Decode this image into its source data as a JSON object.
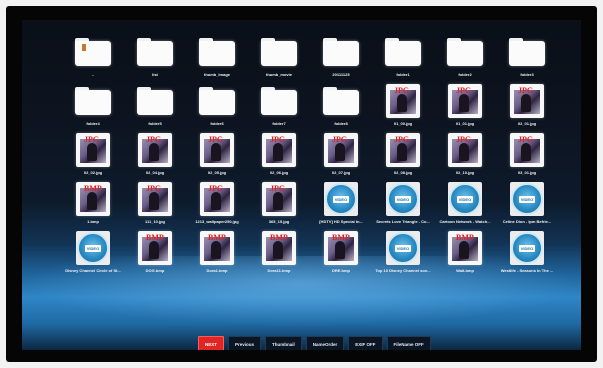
{
  "toolbar": {
    "buttons": [
      {
        "label": "NEXT",
        "active": true
      },
      {
        "label": "Previous",
        "active": false
      },
      {
        "label": "Thumbnail",
        "active": false
      },
      {
        "label": "NameOrder",
        "active": false
      },
      {
        "label": "EXIF OFF",
        "active": false
      },
      {
        "label": "FileName OFF",
        "active": false
      }
    ]
  },
  "colors": {
    "active_button": "#e02525",
    "screen_glow": "#2f86c6",
    "video_accent": "#2a8cc4"
  },
  "files": [
    {
      "type": "folder",
      "name": "..",
      "icon": "folder-up-icon"
    },
    {
      "type": "folder",
      "name": "list",
      "icon": "folder-icon"
    },
    {
      "type": "folder",
      "name": "thumb_image",
      "icon": "folder-icon"
    },
    {
      "type": "folder",
      "name": "thumb_movie",
      "icon": "folder-icon"
    },
    {
      "type": "folder",
      "name": "20111125",
      "icon": "folder-icon"
    },
    {
      "type": "folder",
      "name": "folder1",
      "icon": "folder-icon"
    },
    {
      "type": "folder",
      "name": "folder2",
      "icon": "folder-icon"
    },
    {
      "type": "folder",
      "name": "folder3",
      "icon": "folder-icon"
    },
    {
      "type": "folder",
      "name": "folder4",
      "icon": "folder-icon"
    },
    {
      "type": "folder",
      "name": "folder5",
      "icon": "folder-icon"
    },
    {
      "type": "folder",
      "name": "folder6",
      "icon": "folder-icon"
    },
    {
      "type": "folder",
      "name": "folder7",
      "icon": "folder-icon"
    },
    {
      "type": "folder",
      "name": "folder8",
      "icon": "folder-icon"
    },
    {
      "type": "image",
      "badge": "JPG",
      "name": "01_00.jpg"
    },
    {
      "type": "image",
      "badge": "JPG",
      "name": "01_01.jpg"
    },
    {
      "type": "image",
      "badge": "JPG",
      "name": "02_01.jpg"
    },
    {
      "type": "image",
      "badge": "JPG",
      "name": "02_02.jpg"
    },
    {
      "type": "image",
      "badge": "JPG",
      "name": "02_04.jpg"
    },
    {
      "type": "image",
      "badge": "JPG",
      "name": "02_05.jpg"
    },
    {
      "type": "image",
      "badge": "JPG",
      "name": "02_06.jpg"
    },
    {
      "type": "image",
      "badge": "JPG",
      "name": "02_07.jpg"
    },
    {
      "type": "image",
      "badge": "JPG",
      "name": "02_08.jpg"
    },
    {
      "type": "image",
      "badge": "JPG",
      "name": "02_10.jpg"
    },
    {
      "type": "image",
      "badge": "JPG",
      "name": "03_01.jpg"
    },
    {
      "type": "image",
      "badge": "BMP",
      "name": "1.bmp"
    },
    {
      "type": "image",
      "badge": "JPG",
      "name": "111_10.jpg"
    },
    {
      "type": "image",
      "badge": "JPG",
      "name": "1213_wallpaper250.jpg"
    },
    {
      "type": "image",
      "badge": "JPG",
      "name": "365_15.jpg"
    },
    {
      "type": "video",
      "name": "[HDTV] HD Special In..."
    },
    {
      "type": "video",
      "name": "Secrets Love Triangle - Co..."
    },
    {
      "type": "video",
      "name": "Cartoon Network - Watch..."
    },
    {
      "type": "video",
      "name": "Celine Dion - Ipm Befrie..."
    },
    {
      "type": "video",
      "name": "Disney Channel Circle of St..."
    },
    {
      "type": "image",
      "badge": "BMP",
      "name": "DOG.bmp"
    },
    {
      "type": "image",
      "badge": "BMP",
      "name": "Dora1.bmp"
    },
    {
      "type": "image",
      "badge": "BMP",
      "name": "Dora11.bmp"
    },
    {
      "type": "image",
      "badge": "BMP",
      "name": "DRE.bmp"
    },
    {
      "type": "video",
      "name": "Top 10 Disney Channel son..."
    },
    {
      "type": "image",
      "badge": "BMP",
      "name": "Walt.bmp"
    },
    {
      "type": "video",
      "name": "Westlife - Seasons In The ..."
    }
  ]
}
